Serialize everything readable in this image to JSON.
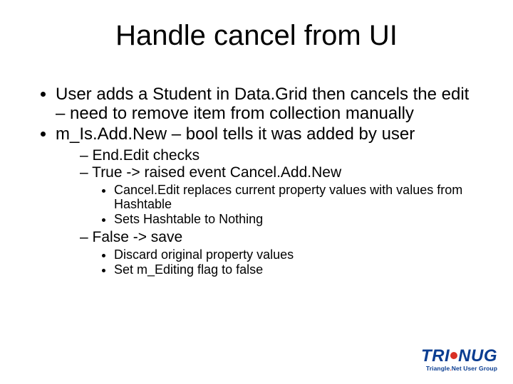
{
  "title": "Handle cancel from UI",
  "bullets": {
    "b1": "User adds a Student in Data.Grid then cancels the edit – need to remove item from collection manually",
    "b2": "m_Is.Add.New – bool tells it was added by user",
    "b2_1": "End.Edit checks",
    "b2_2": "True -> raised event Cancel.Add.New",
    "b2_2_1": "Cancel.Edit replaces current property values with values from Hashtable",
    "b2_2_2": "Sets Hashtable to Nothing",
    "b2_3": "False -> save",
    "b2_3_1": "Discard original property values",
    "b2_3_2": "Set m_Editing flag to false"
  },
  "logo": {
    "left": "TRI",
    "right": "NUG",
    "sub_left": "Triangle",
    "sub_mid": ".",
    "sub_right": "Net User Group"
  }
}
